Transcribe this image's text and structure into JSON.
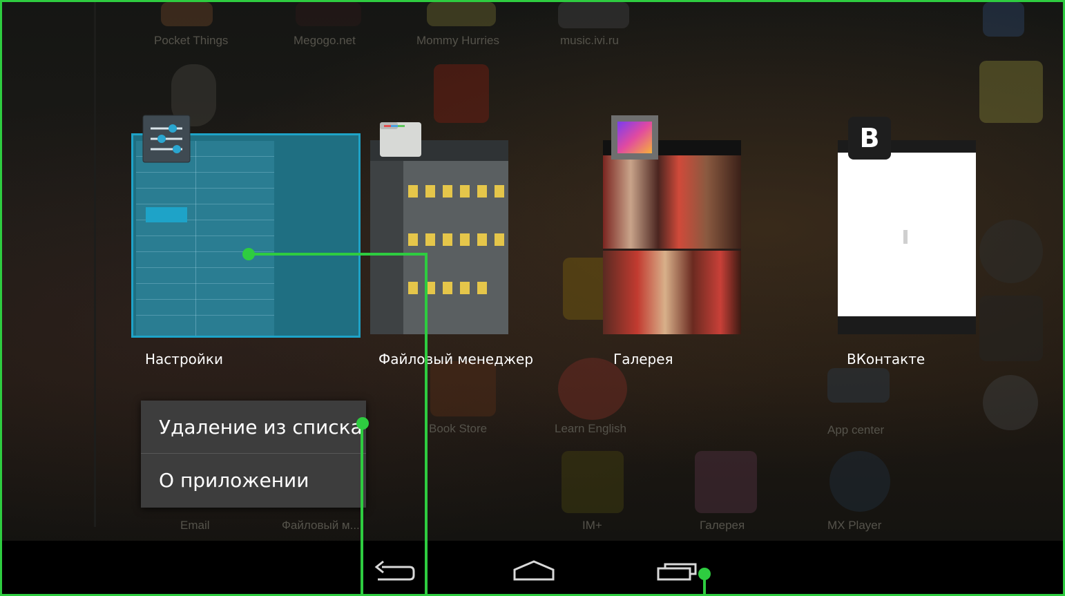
{
  "background_launcher": {
    "top_row_labels": [
      "Pocket Things",
      "Megogo.net",
      "Mommy Hurries",
      "music.ivi.ru"
    ],
    "mid_row_labels": [
      "Book Store",
      "Learn English",
      "App center"
    ],
    "bottom_row_labels": [
      "Email",
      "Файловый м...",
      "IM+",
      "Галерея",
      "MX Player"
    ]
  },
  "recent_apps": [
    {
      "label": "Настройки",
      "icon": "settings-sliders-icon"
    },
    {
      "label": "Файловый менеджер",
      "icon": "folder-icon"
    },
    {
      "label": "Галерея",
      "icon": "gallery-icon"
    },
    {
      "label": "ВКонтакте",
      "icon": "vk-icon",
      "icon_letter": "B"
    }
  ],
  "context_menu": {
    "items": [
      "Удаление из списка",
      "О приложении"
    ]
  },
  "navbar": {
    "buttons": [
      "back-icon",
      "home-icon",
      "recent-apps-icon"
    ]
  },
  "colors": {
    "callout": "#2ecc40",
    "settings_accent": "#1ea3c8",
    "menu_bg": "#3d3d3d"
  }
}
